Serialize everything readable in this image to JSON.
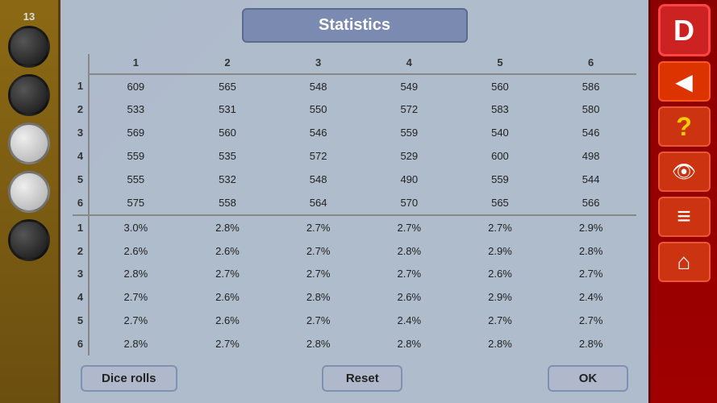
{
  "title": "Statistics",
  "close_icon": "✕",
  "table": {
    "col_headers": [
      "",
      "1",
      "2",
      "3",
      "4",
      "5",
      "6"
    ],
    "count_rows": [
      [
        "1",
        "609",
        "565",
        "548",
        "549",
        "560",
        "586"
      ],
      [
        "2",
        "533",
        "531",
        "550",
        "572",
        "583",
        "580"
      ],
      [
        "3",
        "569",
        "560",
        "546",
        "559",
        "540",
        "546"
      ],
      [
        "4",
        "559",
        "535",
        "572",
        "529",
        "600",
        "498"
      ],
      [
        "5",
        "555",
        "532",
        "548",
        "490",
        "559",
        "544"
      ],
      [
        "6",
        "575",
        "558",
        "564",
        "570",
        "565",
        "566"
      ]
    ],
    "pct_rows": [
      [
        "1",
        "3.0%",
        "2.8%",
        "2.7%",
        "2.7%",
        "2.7%",
        "2.9%"
      ],
      [
        "2",
        "2.6%",
        "2.6%",
        "2.7%",
        "2.8%",
        "2.9%",
        "2.8%"
      ],
      [
        "3",
        "2.8%",
        "2.7%",
        "2.7%",
        "2.7%",
        "2.6%",
        "2.7%"
      ],
      [
        "4",
        "2.7%",
        "2.6%",
        "2.8%",
        "2.6%",
        "2.9%",
        "2.4%"
      ],
      [
        "5",
        "2.7%",
        "2.6%",
        "2.7%",
        "2.4%",
        "2.7%",
        "2.7%"
      ],
      [
        "6",
        "2.8%",
        "2.7%",
        "2.8%",
        "2.8%",
        "2.8%",
        "2.8%"
      ]
    ]
  },
  "buttons": {
    "dice_rolls": "Dice rolls",
    "reset": "Reset",
    "ok": "OK"
  },
  "right_panel": {
    "dice_label": "D",
    "back_icon": "◀",
    "question_icon": "?",
    "eye_icon": "👁",
    "list_icon": "≡",
    "home_icon": "⌂"
  },
  "score_top": "13",
  "checkers": [
    "dark",
    "dark",
    "light",
    "light",
    "dark"
  ]
}
